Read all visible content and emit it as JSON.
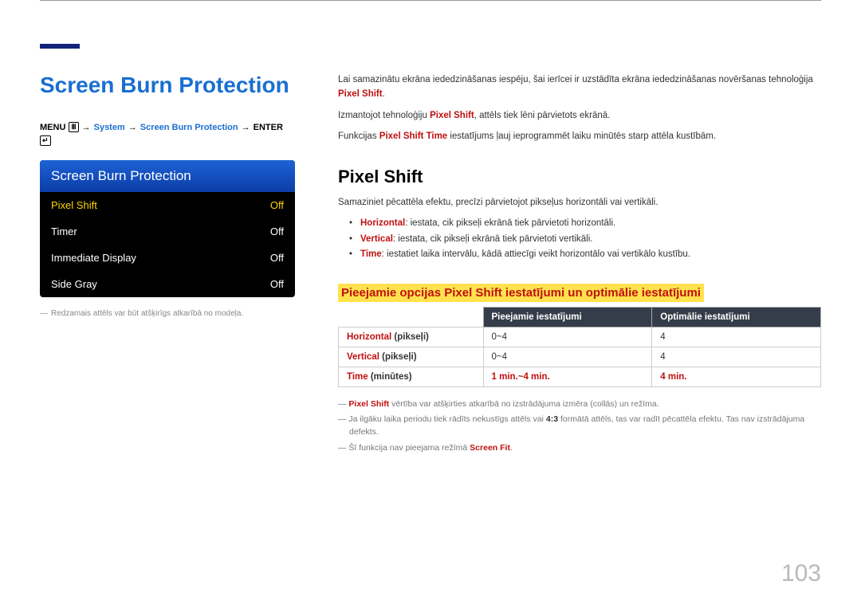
{
  "page_number": "103",
  "page_title": "Screen Burn Protection",
  "breadcrumb": {
    "menu": "MENU",
    "system": "System",
    "arrow": "→",
    "sbp": "Screen Burn Protection",
    "enter": "ENTER"
  },
  "osd": {
    "title": "Screen Burn Protection",
    "rows": [
      {
        "label": "Pixel Shift",
        "value": "Off",
        "selected": true
      },
      {
        "label": "Timer",
        "value": "Off",
        "selected": false
      },
      {
        "label": "Immediate Display",
        "value": "Off",
        "selected": false
      },
      {
        "label": "Side Gray",
        "value": "Off",
        "selected": false
      }
    ],
    "note_dash": "―",
    "note": "Redzamais attēls var būt atšķirīgs atkarībā no modeļa."
  },
  "intro": {
    "p1_pre": "Lai samazinātu ekrāna iededzināšanas iespēju, šai ierīcei ir uzstādīta ekrāna iededzināšanas novēršanas tehnoloģija ",
    "p1_hl": "Pixel Shift",
    "p1_post": ".",
    "p2_pre": "Izmantojot tehnoloģiju ",
    "p2_hl": "Pixel Shift",
    "p2_post": ", attēls tiek lēni pārvietots ekrānā.",
    "p3_pre": "Funkcijas ",
    "p3_hl": "Pixel Shift Time",
    "p3_post": " iestatījums ļauj ieprogrammēt laiku minūtēs starp attēla kustībām."
  },
  "section2": {
    "title": "Pixel Shift",
    "lead": "Samaziniet pēcattēla efektu, precīzi pārvietojot pikseļus horizontāli vai vertikāli.",
    "bullets": [
      {
        "term": "Horizontal",
        "text": ": iestata, cik pikseļi ekrānā tiek pārvietoti horizontāli."
      },
      {
        "term": "Vertical",
        "text": ": iestata, cik pikseļi ekrānā tiek pārvietoti vertikāli."
      },
      {
        "term": "Time",
        "text": ": iestatiet laika intervālu, kādā attiecīgi veikt horizontālo vai vertikālo kustību."
      }
    ]
  },
  "table": {
    "heading": "Pieejamie opcijas Pixel Shift iestatījumi un optimālie iestatījumi",
    "col1": "Pieejamie iestatījumi",
    "col2": "Optimālie iestatījumi",
    "rows": [
      {
        "label_red": "Horizontal",
        "label_rest": " (pikseļi)",
        "avail": "0~4",
        "optimal": "4",
        "highlight": false
      },
      {
        "label_red": "Vertical",
        "label_rest": " (pikseļi)",
        "avail": "0~4",
        "optimal": "4",
        "highlight": false
      },
      {
        "label_red": "Time",
        "label_rest": " (minūtes)",
        "avail": "1 min.~4 min.",
        "optimal": "4 min.",
        "highlight": true
      }
    ]
  },
  "notes": {
    "n1_dash": "―",
    "n1_red": "Pixel Shift",
    "n1_rest": " vērtība var atšķirties atkarībā no izstrādājuma izmēra (collās) un režīma.",
    "n2_dash": "―",
    "n2_pre": "Ja ilgāku laika periodu tiek rādīts nekustīgs attēls vai ",
    "n2_bold": "4:3",
    "n2_post": " formātā attēls, tas var radīt pēcattēla efektu. Tas nav izstrādājuma defekts.",
    "n3_dash": "―",
    "n3_pre": "Šī funkcija nav pieejama režīmā ",
    "n3_red": "Screen Fit",
    "n3_post": "."
  }
}
